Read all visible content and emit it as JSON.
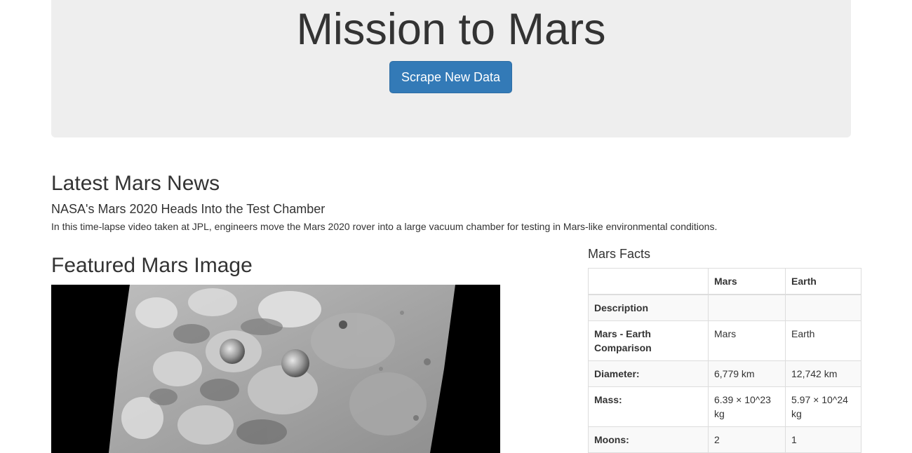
{
  "header": {
    "title": "Mission to Mars",
    "scrape_button_label": "Scrape New Data"
  },
  "news": {
    "heading": "Latest Mars News",
    "title": "NASA's Mars 2020 Heads Into the Test Chamber",
    "teaser": "In this time-lapse video taken at JPL, engineers move the Mars 2020 rover into a large vacuum chamber for testing in Mars-like environmental conditions."
  },
  "featured": {
    "heading": "Featured Mars Image"
  },
  "facts": {
    "heading": "Mars Facts",
    "columns": [
      "",
      "Mars",
      "Earth"
    ],
    "rows": [
      {
        "label": "Description",
        "mars": "",
        "earth": ""
      },
      {
        "label": "Mars - Earth Comparison",
        "mars": "Mars",
        "earth": "Earth"
      },
      {
        "label": "Diameter:",
        "mars": "6,779 km",
        "earth": "12,742 km"
      },
      {
        "label": "Mass:",
        "mars": "6.39 × 10^23 kg",
        "earth": "5.97 × 10^24 kg"
      },
      {
        "label": "Moons:",
        "mars": "2",
        "earth": "1"
      }
    ]
  },
  "colors": {
    "jumbotron_bg": "#eeeeee",
    "button_primary": "#337ab7",
    "text": "#333333"
  }
}
